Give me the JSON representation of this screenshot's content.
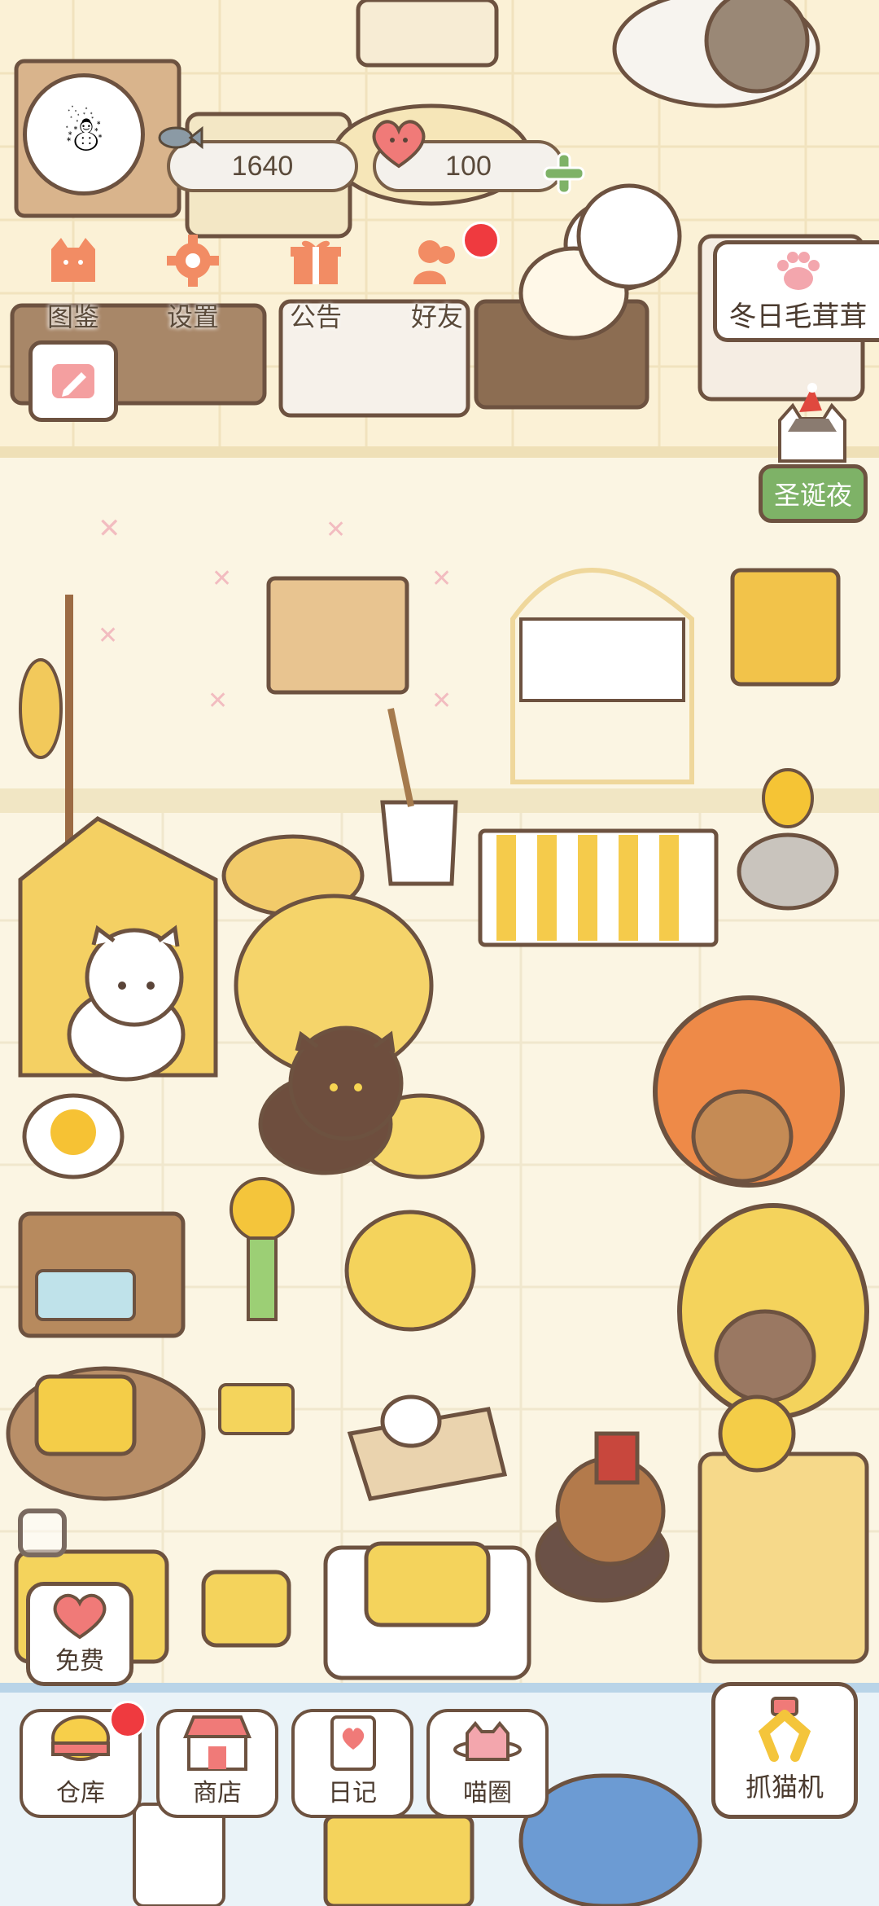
{
  "hud": {
    "player_avatar": "snowman-avatar",
    "currency_fish": {
      "icon": "fish-icon",
      "value": "1640"
    },
    "currency_heart": {
      "icon": "heart-coin-icon",
      "value": "100",
      "add_icon": "plus-icon"
    },
    "menu": [
      {
        "icon": "cat-face-icon",
        "label": "图鉴"
      },
      {
        "icon": "gear-icon",
        "label": "设置"
      },
      {
        "icon": "gift-icon",
        "label": "公告"
      },
      {
        "icon": "friends-icon",
        "label": "好友",
        "badge": true
      }
    ],
    "edit_icon": "pencil-icon"
  },
  "events": {
    "winter_event": {
      "label": "冬日毛茸茸",
      "icon": "paw-icon"
    },
    "christmas": {
      "label": "圣诞夜",
      "icon": "santa-cat-icon"
    }
  },
  "free_button": {
    "label": "免费",
    "icon": "heart-icon"
  },
  "bottom_bar": [
    {
      "icon": "bowl-icon",
      "label": "仓库",
      "badge": true
    },
    {
      "icon": "shop-icon",
      "label": "商店"
    },
    {
      "icon": "diary-icon",
      "label": "日记"
    },
    {
      "icon": "planet-cat-icon",
      "label": "喵圈"
    }
  ],
  "claw_machine": {
    "label": "抓猫机",
    "icon": "claw-icon"
  },
  "colors": {
    "accent_green": "#7eb267",
    "badge_red": "#ef3a3f",
    "outline": "#6d5240"
  }
}
